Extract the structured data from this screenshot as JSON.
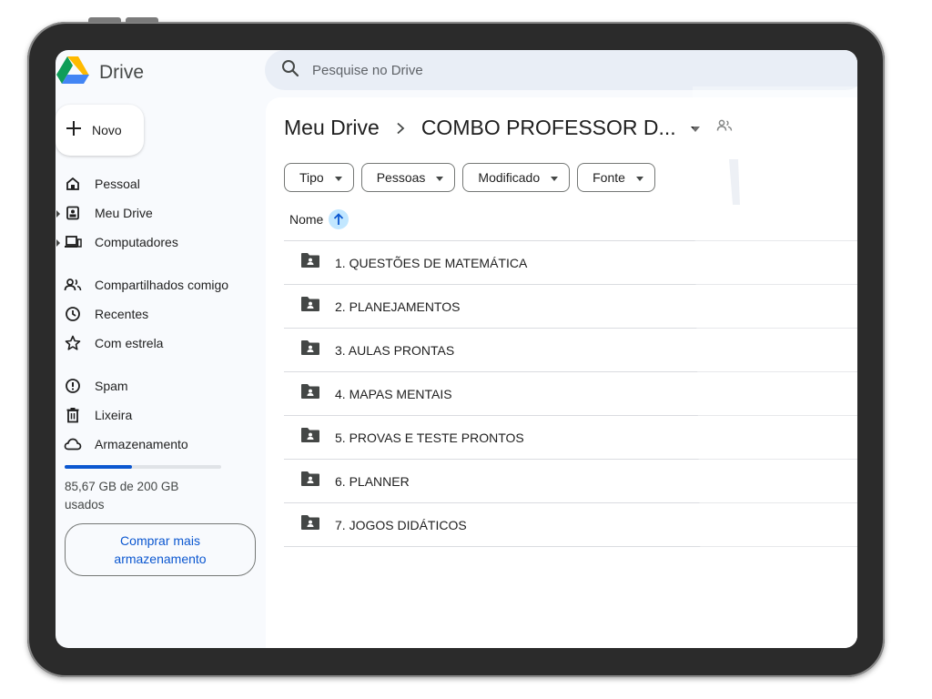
{
  "app": {
    "name": "Drive"
  },
  "search": {
    "placeholder": "Pesquise no Drive"
  },
  "new_button": {
    "label": "Novo"
  },
  "sidebar": {
    "items": [
      {
        "label": "Pessoal",
        "icon": "home-icon"
      },
      {
        "label": "Meu Drive",
        "icon": "my-drive-icon"
      },
      {
        "label": "Computadores",
        "icon": "computer-icon"
      },
      {
        "label": "Compartilhados comigo",
        "icon": "shared-people-icon"
      },
      {
        "label": "Recentes",
        "icon": "clock-icon"
      },
      {
        "label": "Com estrela",
        "icon": "star-icon"
      },
      {
        "label": "Spam",
        "icon": "spam-icon"
      },
      {
        "label": "Lixeira",
        "icon": "trash-icon"
      },
      {
        "label": "Armazenamento",
        "icon": "cloud-icon"
      }
    ]
  },
  "storage": {
    "used_fraction": 0.428,
    "text": "85,67 GB de 200 GB usados",
    "buy_label": "Comprar mais armazenamento"
  },
  "breadcrumb": {
    "root": "Meu Drive",
    "current": "COMBO PROFESSOR D..."
  },
  "filters": [
    "Tipo",
    "Pessoas",
    "Modificado",
    "Fonte"
  ],
  "sort": {
    "label": "Nome",
    "direction": "ascending"
  },
  "files": [
    "1. QUESTÕES DE MATEMÁTICA",
    "2. PLANEJAMENTOS",
    "3. AULAS PRONTAS",
    "4. MAPAS MENTAIS",
    "5. PROVAS E TESTE PRONTOS",
    "6. PLANNER",
    "7. JOGOS DIDÁTICOS"
  ],
  "colors": {
    "accent": "#0b57d0",
    "search_bg": "#e9eef6",
    "sort_chip": "#c2e7ff"
  }
}
